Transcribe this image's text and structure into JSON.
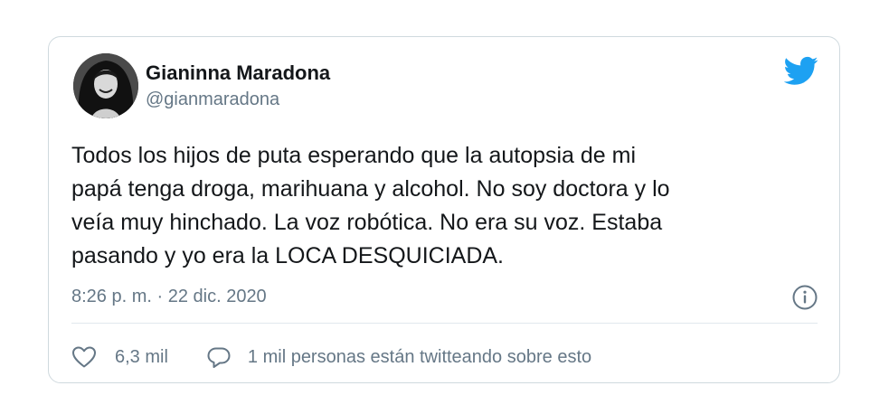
{
  "tweet": {
    "author": {
      "name": "Gianinna Maradona",
      "handle": "@gianmaradona"
    },
    "text": "Todos los hijos de puta esperando que la autopsia de mi\npapá tenga droga, marihuana y alcohol. No soy doctora y lo\nveía muy hinchado. La voz robótica. No era su voz. Estaba\npasando y yo era la LOCA DESQUICIADA.",
    "timestamp": "8:26 p. m. · 22 dic. 2020",
    "likes": "6,3 mil",
    "conversation": "1 mil personas están twitteando sobre esto"
  },
  "colors": {
    "twitter_blue": "#1da1f2",
    "text_primary": "#14171a",
    "text_secondary": "#657786",
    "border": "#cfd9de"
  },
  "icons": {
    "brand": "twitter-bird-icon",
    "info": "info-icon",
    "like": "heart-icon",
    "reply": "speech-bubble-icon"
  }
}
